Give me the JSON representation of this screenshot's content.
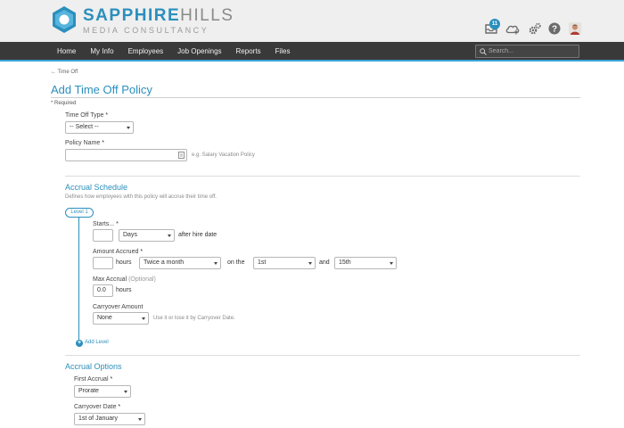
{
  "brand": {
    "name_part1": "SAPPHIRE",
    "name_part2": "HILLS",
    "subtitle": "MEDIA CONSULTANCY"
  },
  "header": {
    "notification_count": "11",
    "icons": [
      "inbox-icon",
      "cloud-upload-icon",
      "settings-icon",
      "help-icon",
      "user-avatar"
    ]
  },
  "nav": {
    "items": [
      "Home",
      "My Info",
      "Employees",
      "Job Openings",
      "Reports",
      "Files"
    ],
    "search_placeholder": "Search..."
  },
  "page": {
    "back_link": "← Time Off",
    "title": "Add Time Off Policy",
    "required_note": "* Required"
  },
  "form": {
    "time_off_type": {
      "label": "Time Off Type",
      "required": "*",
      "value": "-- Select --"
    },
    "policy_name": {
      "label": "Policy Name",
      "required": "*",
      "value": "",
      "hint": "e.g. Salary Vacation Policy"
    }
  },
  "accrual_schedule": {
    "title": "Accrual Schedule",
    "description": "Defines how employees with this policy will accrue their time off.",
    "level_label": "Level 1",
    "starts": {
      "label": "Starts...",
      "required": "*",
      "value": "",
      "unit": "Days",
      "suffix": "after hire date"
    },
    "amount_accrued": {
      "label": "Amount Accrued",
      "required": "*",
      "value": "",
      "unit_text": "hours",
      "frequency": "Twice a month",
      "on_text": "on the",
      "day1": "1st",
      "and_text": "and",
      "day2": "15th"
    },
    "max_accrual": {
      "label": "Max Accrual",
      "optional": "(Optional)",
      "value": "0.0",
      "unit_text": "hours"
    },
    "carryover_amount": {
      "label": "Carryover Amount",
      "value": "None",
      "hint": "Use it or lose it by Carryover Date."
    },
    "add_level": "Add Level"
  },
  "accrual_options": {
    "title": "Accrual Options",
    "first_accrual": {
      "label": "First Accrual",
      "required": "*",
      "value": "Prorate"
    },
    "carryover_date": {
      "label": "Carryover Date",
      "required": "*",
      "value": "1st of January"
    }
  },
  "colors": {
    "accent": "#2a8fbd",
    "nav_bg": "#393939",
    "header_bg": "#efefef",
    "nav_underline": "#3aa3d6"
  }
}
